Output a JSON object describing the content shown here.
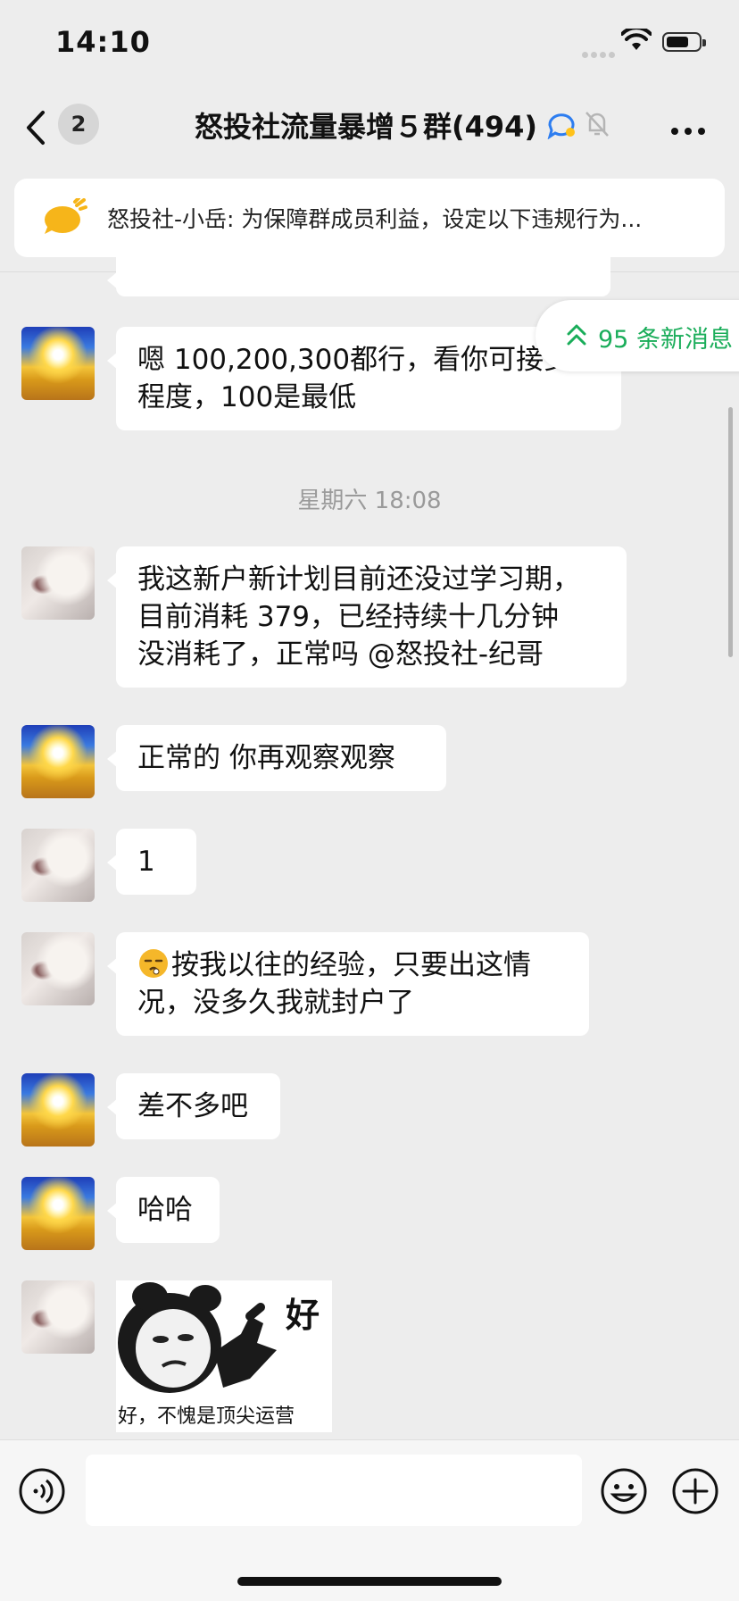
{
  "status_bar": {
    "time": "14:10"
  },
  "nav": {
    "unread_count": "2",
    "title": "怒投社流量暴增５群(494)"
  },
  "notice": {
    "text": "怒投社-小岳: 为保障群成员利益，设定以下违规行为..."
  },
  "new_messages_pill": {
    "label": "95 条新消息"
  },
  "timestamp": "星期六 18:08",
  "messages": [
    {
      "avatar": "sun",
      "lines": [
        "嗯  100,200,300都行，看你可接受",
        "程度，100是最低"
      ]
    },
    {
      "avatar": "anime",
      "lines": [
        "我这新户新计划目前还没过学习期，",
        "目前消耗 379，已经持续十几分钟",
        "没消耗了，正常吗 @怒投社-纪哥"
      ]
    },
    {
      "avatar": "sun",
      "lines": [
        "正常的  你再观察观察"
      ]
    },
    {
      "avatar": "anime",
      "lines": [
        "1"
      ]
    },
    {
      "avatar": "anime",
      "lines": [
        "按我以往的经验，只要出这情",
        "况，没多久我就封户了"
      ]
    },
    {
      "avatar": "sun",
      "lines": [
        "差不多吧"
      ]
    },
    {
      "avatar": "sun",
      "lines": [
        "哈哈"
      ]
    }
  ],
  "sticker": {
    "top_text": "好",
    "caption": "好，不愧是顶尖运营"
  },
  "input": {
    "placeholder": ""
  }
}
